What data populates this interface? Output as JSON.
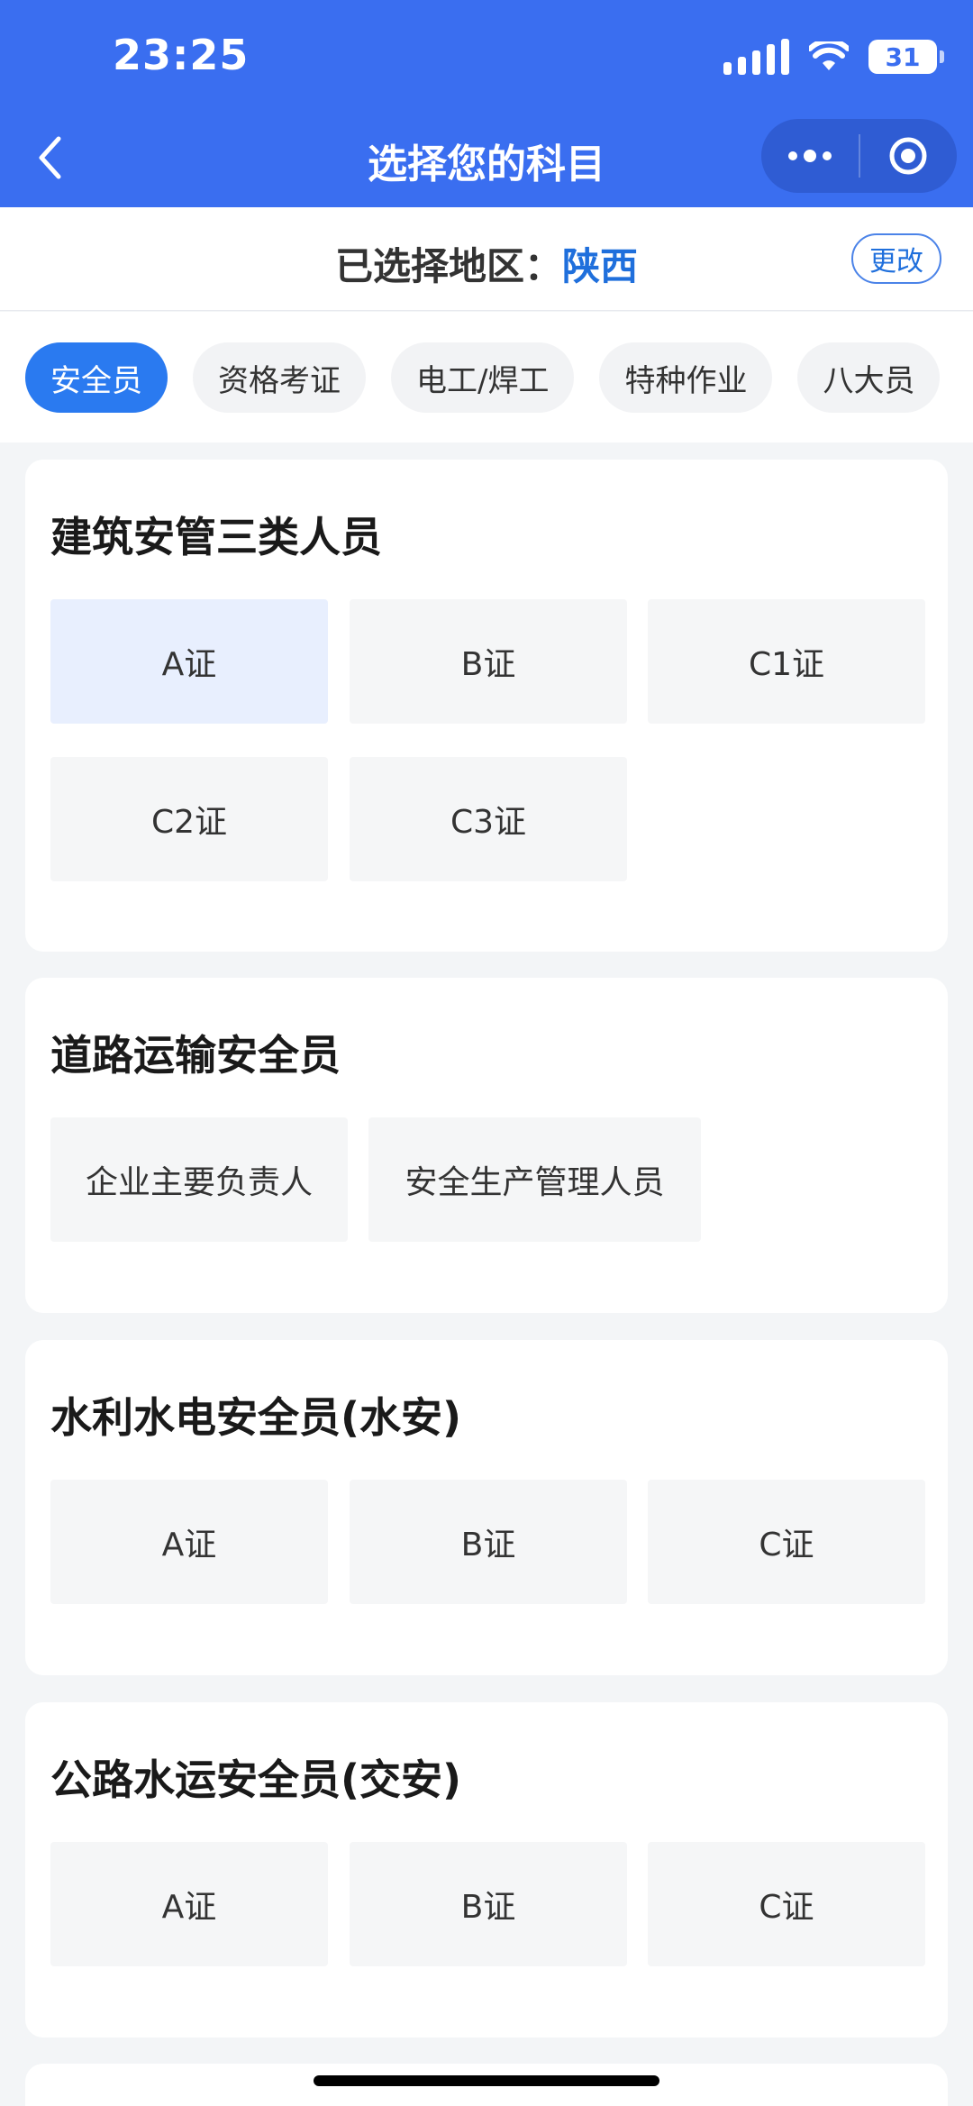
{
  "status_bar": {
    "time": "23:25",
    "battery": "31"
  },
  "nav": {
    "title": "选择您的科目"
  },
  "region": {
    "prefix": "已选择地区：",
    "value": "陕西",
    "change_label": "更改"
  },
  "tabs": [
    {
      "label": "安全员",
      "active": true
    },
    {
      "label": "资格考证"
    },
    {
      "label": "电工/焊工"
    },
    {
      "label": "特种作业"
    },
    {
      "label": "八大员"
    }
  ],
  "sections": [
    {
      "title": "建筑安管三类人员",
      "options": [
        "A证",
        "B证",
        "C1证",
        "C2证",
        "C3证"
      ],
      "selected_index": 0
    },
    {
      "title": "道路运输安全员",
      "options": [
        "企业主要负责人",
        "安全生产管理人员"
      ]
    },
    {
      "title": "水利水电安全员(水安)",
      "options": [
        "A证",
        "B证",
        "C证"
      ]
    },
    {
      "title": "公路水运安全员(交安)",
      "options": [
        "A证",
        "B证",
        "C证"
      ]
    }
  ],
  "colors": {
    "header": "#3a6ef0",
    "accent": "#2a7af0",
    "region_value": "#1f6fdc",
    "selected_option": "#e8effe"
  }
}
